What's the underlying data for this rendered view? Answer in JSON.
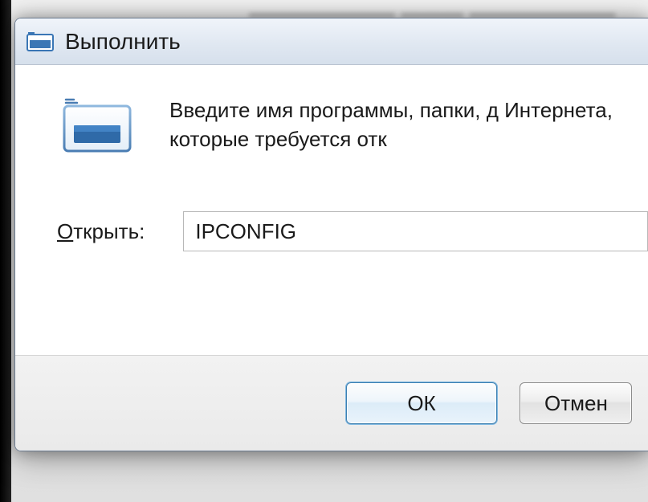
{
  "window": {
    "title": "Выполнить",
    "description": "Введите имя программы, папки, д Интернета, которые требуется отк",
    "open_label_prefix": "О",
    "open_label_rest": "ткрыть:",
    "input_value": "IPCONFIG"
  },
  "buttons": {
    "ok": "ОК",
    "cancel": "Отмен"
  },
  "icons": {
    "title_icon": "run-small-icon",
    "main_icon": "run-large-icon"
  }
}
